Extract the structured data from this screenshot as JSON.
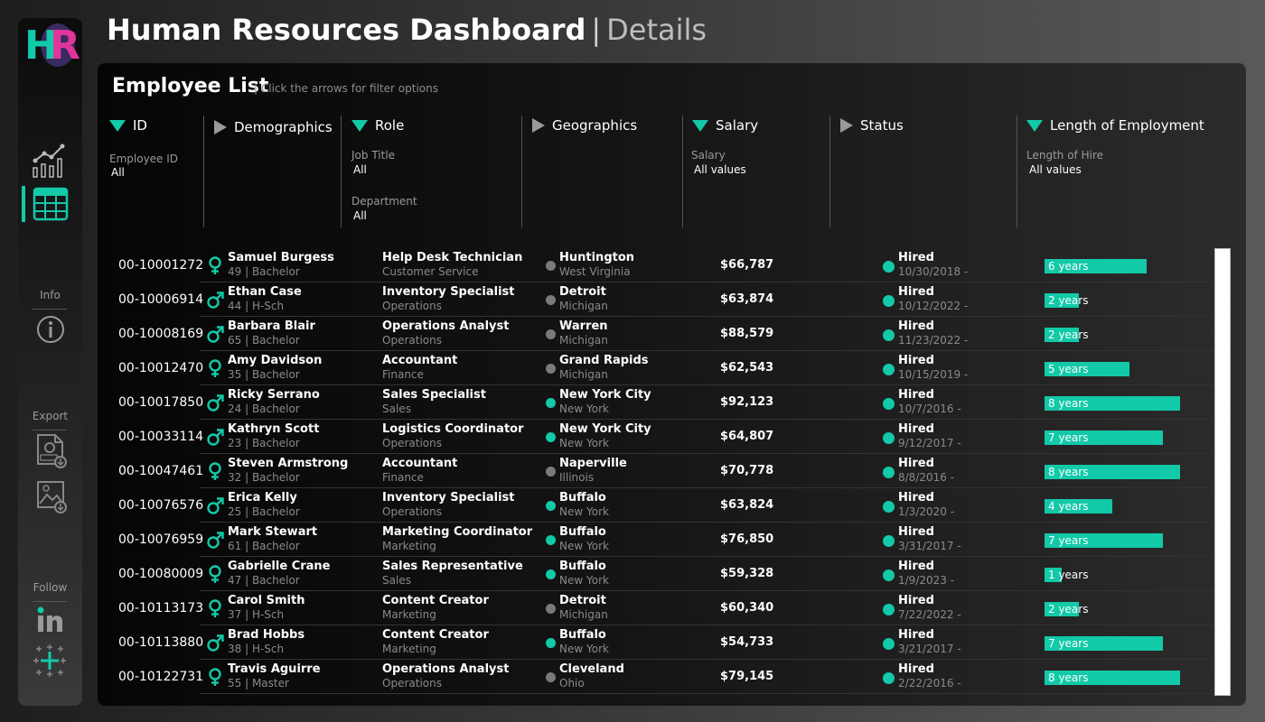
{
  "app": {
    "title": "Human Resources Dashboard",
    "separator": "|",
    "subtitle": "Details"
  },
  "sidebar": {
    "logo_h": "H",
    "logo_r": "R",
    "info_label": "Info",
    "export_label": "Export",
    "follow_label": "Follow",
    "colors": {
      "accent": "#12c9a8",
      "pink": "#e0359b"
    }
  },
  "panel": {
    "title": "Employee List",
    "hint": "| Click the arrows for filter options"
  },
  "filters": {
    "id": {
      "label": "ID",
      "field_label": "Employee ID",
      "value": "All",
      "expanded": true
    },
    "demographics": {
      "label": "Demographics",
      "expanded": false
    },
    "role": {
      "label": "Role",
      "job_title_label": "Job Title",
      "job_title_value": "All",
      "department_label": "Department",
      "department_value": "All",
      "expanded": true
    },
    "geographics": {
      "label": "Geographics",
      "expanded": false
    },
    "salary": {
      "label": "Salary",
      "field_label": "Salary",
      "value": "All values",
      "expanded": true
    },
    "status": {
      "label": "Status",
      "expanded": false
    },
    "length": {
      "label": "Length of Employment",
      "field_label": "Length of Hire",
      "value": "All values",
      "expanded": true
    }
  },
  "employees": [
    {
      "id": "00-10001272",
      "gender": "female",
      "name": "Samuel Burgess",
      "demo": "49 | Bachelor",
      "job": "Help Desk Technician",
      "dept": "Customer Service",
      "city": "Huntington",
      "state": "West Virginia",
      "geo_color": "#7a7a7a",
      "salary": "$66,787",
      "status": "Hired",
      "hire_date": "10/30/2018 -",
      "years": 6,
      "years_label": "6 years"
    },
    {
      "id": "00-10006914",
      "gender": "male",
      "name": "Ethan Case",
      "demo": "44 | H-Sch",
      "job": "Inventory Specialist",
      "dept": "Operations",
      "city": "Detroit",
      "state": "Michigan",
      "geo_color": "#7a7a7a",
      "salary": "$63,874",
      "status": "Hired",
      "hire_date": "10/12/2022 -",
      "years": 2,
      "years_label": "2 years"
    },
    {
      "id": "00-10008169",
      "gender": "male",
      "name": "Barbara Blair",
      "demo": "65 | Bachelor",
      "job": "Operations Analyst",
      "dept": "Operations",
      "city": "Warren",
      "state": "Michigan",
      "geo_color": "#7a7a7a",
      "salary": "$88,579",
      "status": "Hired",
      "hire_date": "11/23/2022 -",
      "years": 2,
      "years_label": "2 years"
    },
    {
      "id": "00-10012470",
      "gender": "female",
      "name": "Amy Davidson",
      "demo": "35 | Bachelor",
      "job": "Accountant",
      "dept": "Finance",
      "city": "Grand Rapids",
      "state": "Michigan",
      "geo_color": "#7a7a7a",
      "salary": "$62,543",
      "status": "Hired",
      "hire_date": "10/15/2019 -",
      "years": 5,
      "years_label": "5 years"
    },
    {
      "id": "00-10017850",
      "gender": "male",
      "name": "Ricky Serrano",
      "demo": "24 | Bachelor",
      "job": "Sales Specialist",
      "dept": "Sales",
      "city": "New York City",
      "state": "New York",
      "geo_color": "#12c9a8",
      "salary": "$92,123",
      "status": "Hired",
      "hire_date": "10/7/2016 -",
      "years": 8,
      "years_label": "8 years"
    },
    {
      "id": "00-10033114",
      "gender": "male",
      "name": "Kathryn Scott",
      "demo": "23 | Bachelor",
      "job": "Logistics Coordinator",
      "dept": "Operations",
      "city": "New York City",
      "state": "New York",
      "geo_color": "#12c9a8",
      "salary": "$64,807",
      "status": "Hired",
      "hire_date": "9/12/2017 -",
      "years": 7,
      "years_label": "7 years"
    },
    {
      "id": "00-10047461",
      "gender": "female",
      "name": "Steven Armstrong",
      "demo": "32 | Bachelor",
      "job": "Accountant",
      "dept": "Finance",
      "city": "Naperville",
      "state": "Illinois",
      "geo_color": "#7a7a7a",
      "salary": "$70,778",
      "status": "Hired",
      "hire_date": "8/8/2016 -",
      "years": 8,
      "years_label": "8 years"
    },
    {
      "id": "00-10076576",
      "gender": "male",
      "name": "Erica Kelly",
      "demo": "25 | Bachelor",
      "job": "Inventory Specialist",
      "dept": "Operations",
      "city": "Buffalo",
      "state": "New York",
      "geo_color": "#12c9a8",
      "salary": "$63,824",
      "status": "Hired",
      "hire_date": "1/3/2020 -",
      "years": 4,
      "years_label": "4 years"
    },
    {
      "id": "00-10076959",
      "gender": "male",
      "name": "Mark Stewart",
      "demo": "61 | Bachelor",
      "job": "Marketing Coordinator",
      "dept": "Marketing",
      "city": "Buffalo",
      "state": "New York",
      "geo_color": "#12c9a8",
      "salary": "$76,850",
      "status": "Hired",
      "hire_date": "3/31/2017 -",
      "years": 7,
      "years_label": "7 years"
    },
    {
      "id": "00-10080009",
      "gender": "female",
      "name": "Gabrielle Crane",
      "demo": "47 | Bachelor",
      "job": "Sales Representative",
      "dept": "Sales",
      "city": "Buffalo",
      "state": "New York",
      "geo_color": "#12c9a8",
      "salary": "$59,328",
      "status": "Hired",
      "hire_date": "1/9/2023 -",
      "years": 1,
      "years_label": "1 years"
    },
    {
      "id": "00-10113173",
      "gender": "female",
      "name": "Carol Smith",
      "demo": "37 | H-Sch",
      "job": "Content Creator",
      "dept": "Marketing",
      "city": "Detroit",
      "state": "Michigan",
      "geo_color": "#7a7a7a",
      "salary": "$60,340",
      "status": "Hired",
      "hire_date": "7/22/2022 -",
      "years": 2,
      "years_label": "2 years"
    },
    {
      "id": "00-10113880",
      "gender": "male",
      "name": "Brad Hobbs",
      "demo": "38 | H-Sch",
      "job": "Content Creator",
      "dept": "Marketing",
      "city": "Buffalo",
      "state": "New York",
      "geo_color": "#12c9a8",
      "salary": "$54,733",
      "status": "Hired",
      "hire_date": "3/21/2017 -",
      "years": 7,
      "years_label": "7 years"
    },
    {
      "id": "00-10122731",
      "gender": "female",
      "name": "Travis Aguirre",
      "demo": "55 | Master",
      "job": "Operations Analyst",
      "dept": "Operations",
      "city": "Cleveland",
      "state": "Ohio",
      "geo_color": "#7a7a7a",
      "salary": "$79,145",
      "status": "Hired",
      "hire_date": "2/22/2016 -",
      "years": 8,
      "years_label": "8 years"
    }
  ]
}
